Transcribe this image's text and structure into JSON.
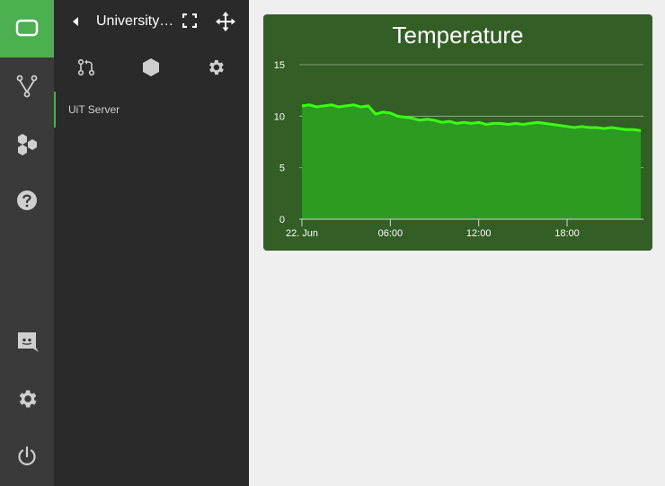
{
  "rail": {
    "items": [
      {
        "icon": "tablet-icon",
        "active": true
      },
      {
        "icon": "git-branch-icon"
      },
      {
        "icon": "hexagons-icon"
      },
      {
        "icon": "help-icon"
      },
      {
        "icon": "discord-icon"
      },
      {
        "icon": "gear-icon"
      },
      {
        "icon": "power-icon"
      }
    ]
  },
  "panel": {
    "title": "University of Tromsø",
    "tabs": [
      "pull-request-icon",
      "hexagon-icon",
      "gear-icon"
    ],
    "server_label": "UiT Server"
  },
  "colors": {
    "accent": "#4caf50",
    "card_bg": "#335e26",
    "line": "#39ff14",
    "area": "#2d9a22"
  },
  "chart_data": {
    "type": "area",
    "title": "Temperature",
    "xlabel": "",
    "ylabel": "",
    "ylim": [
      0,
      15
    ],
    "yticks": [
      0,
      5,
      10,
      15
    ],
    "xlim": [
      0,
      23
    ],
    "xticks": [
      {
        "x": 0,
        "label": "22. Jun"
      },
      {
        "x": 6,
        "label": "06:00"
      },
      {
        "x": 12,
        "label": "12:00"
      },
      {
        "x": 18,
        "label": "18:00"
      }
    ],
    "grid": true,
    "x": [
      0,
      0.5,
      1,
      1.5,
      2,
      2.5,
      3,
      3.5,
      4,
      4.5,
      5,
      5.5,
      6,
      6.5,
      7,
      7.5,
      8,
      8.5,
      9,
      9.5,
      10,
      10.5,
      11,
      11.5,
      12,
      12.5,
      13,
      13.5,
      14,
      14.5,
      15,
      15.5,
      16,
      16.5,
      17,
      17.5,
      18,
      18.5,
      19,
      19.5,
      20,
      20.5,
      21,
      21.5,
      22,
      22.5,
      23
    ],
    "y": [
      11.0,
      11.1,
      10.9,
      11.0,
      11.1,
      10.9,
      11.0,
      11.1,
      10.9,
      11.0,
      10.2,
      10.4,
      10.3,
      10.0,
      9.9,
      9.8,
      9.6,
      9.7,
      9.6,
      9.4,
      9.5,
      9.3,
      9.4,
      9.3,
      9.4,
      9.2,
      9.3,
      9.3,
      9.2,
      9.3,
      9.2,
      9.3,
      9.4,
      9.3,
      9.2,
      9.1,
      9.0,
      8.9,
      9.0,
      8.9,
      8.9,
      8.8,
      8.9,
      8.8,
      8.7,
      8.7,
      8.6
    ]
  }
}
